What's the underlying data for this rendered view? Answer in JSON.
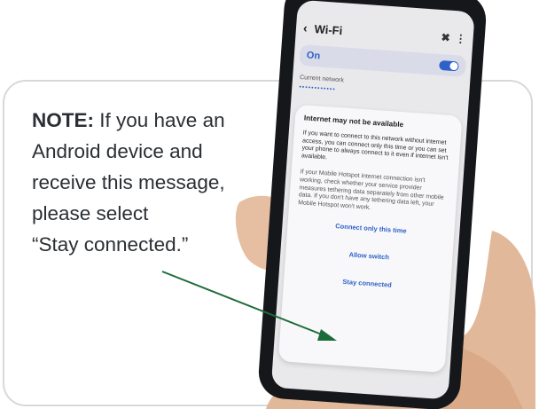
{
  "note": {
    "prefix": "NOTE:",
    "text": " If you have an\nAndroid device and\nreceive this message,\nplease select\n“Stay connected.”"
  },
  "phone": {
    "appbar": {
      "title": "Wi-Fi",
      "back_icon": "chevron-left-icon"
    },
    "wifi_toggle": {
      "label": "On",
      "state": "on"
    },
    "current_network_label": "Current network",
    "current_network_name": "••••••••••••",
    "dialog": {
      "title": "Internet may not be available",
      "message": "If you want to connect to this network without internet access, you can connect only this time or you can set your phone to always connect to it even if internet isn't available.",
      "detail": "If your Mobile Hotspot internet connection isn't working, check whether your service provider measures tethering data separately from other mobile data. If you don't have any tethering data left, your Mobile Hotspot won't work.",
      "buttons": [
        "Connect only this time",
        "Allow switch",
        "Stay connected"
      ]
    }
  },
  "colors": {
    "arrow": "#1e6b3a",
    "accent": "#2f61c8",
    "text": "#2b2f33",
    "card_border": "#d6d9dc"
  }
}
